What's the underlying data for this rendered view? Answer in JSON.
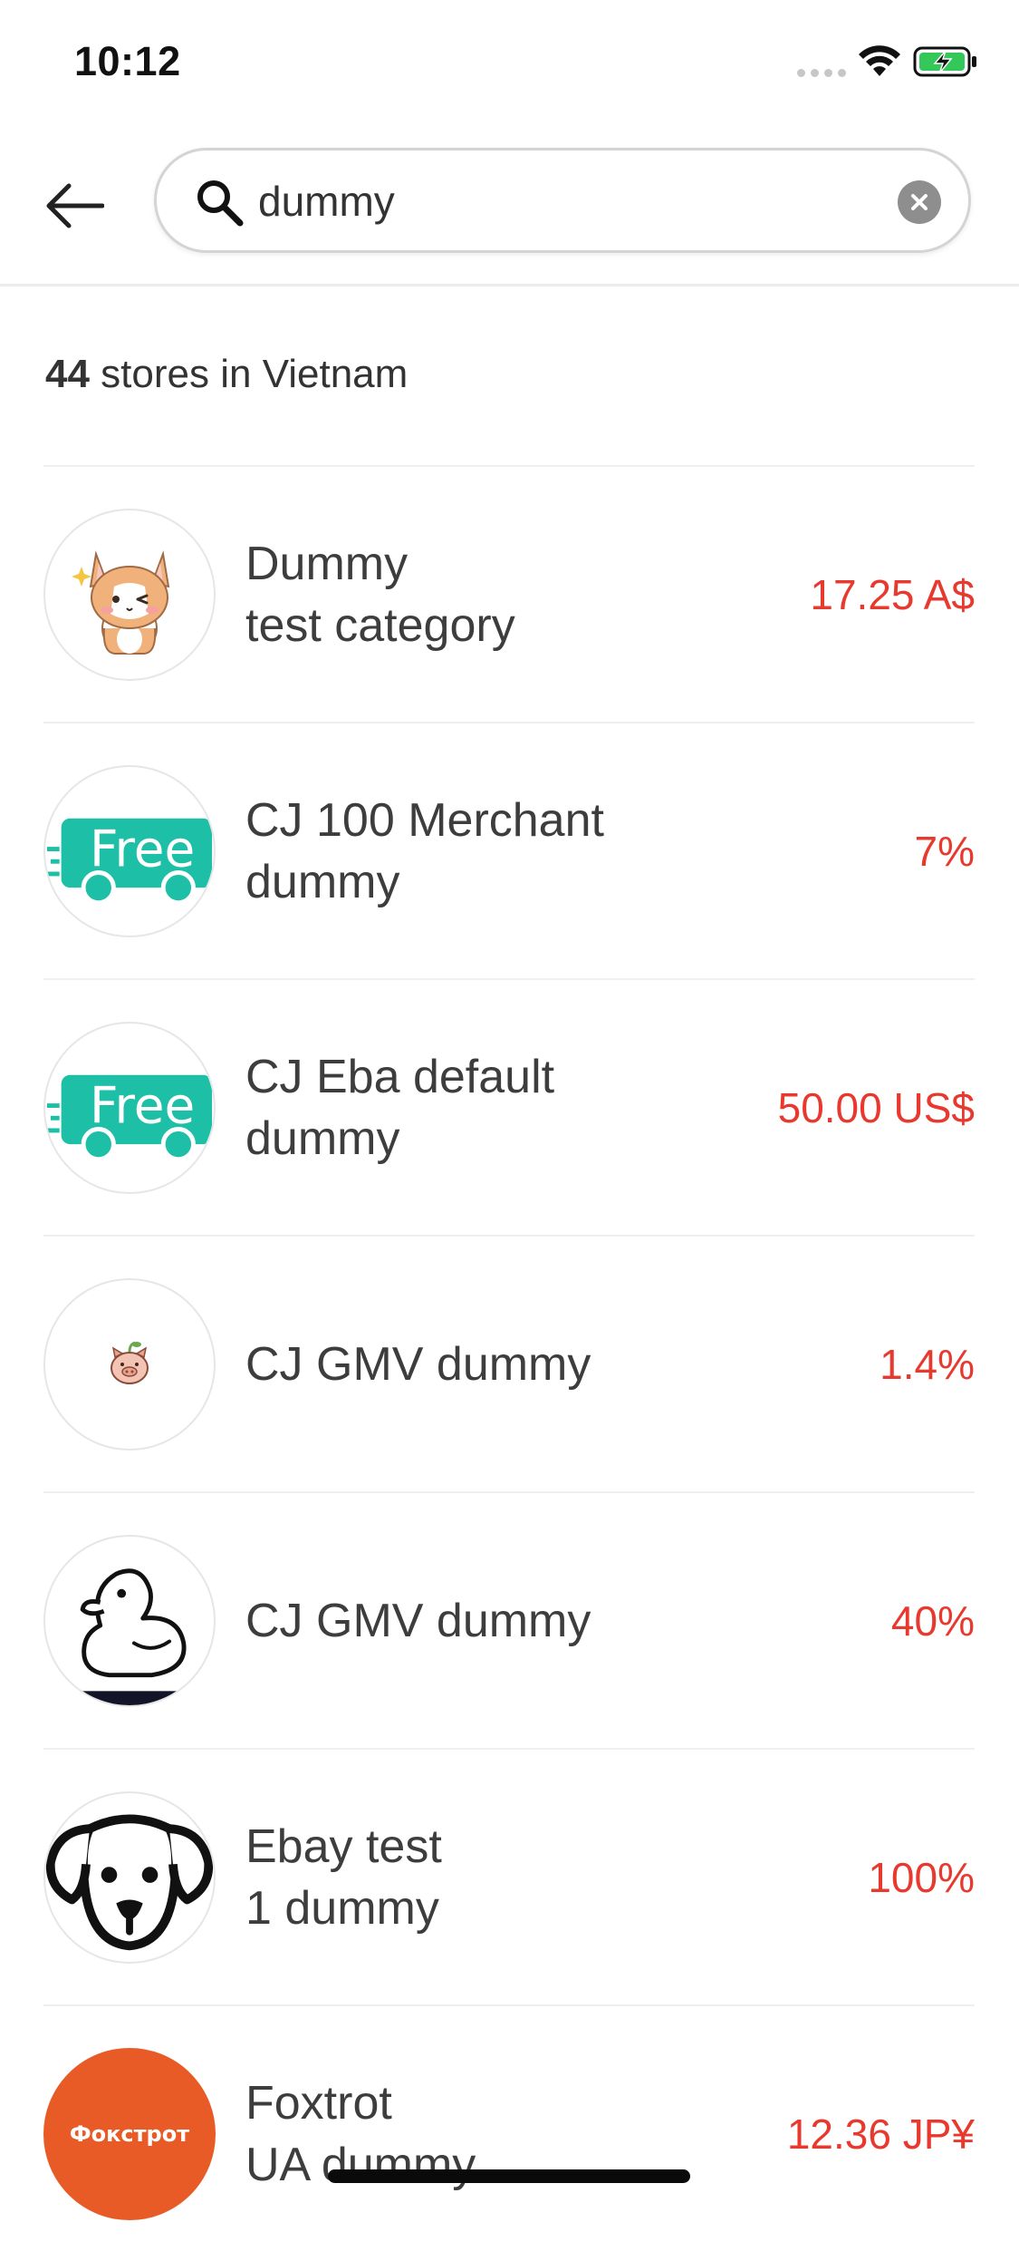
{
  "status_bar": {
    "time": "10:12"
  },
  "header": {
    "back_icon": "arrow-left-icon",
    "search": {
      "value": "dummy",
      "icon": "search-icon",
      "clear_icon": "clear-icon"
    }
  },
  "results": {
    "count": "44",
    "label": " stores in Vietnam"
  },
  "stores": [
    {
      "name_line1": "Dummy",
      "name_line2": "test category",
      "value": "17.25 A$",
      "logo": "cartoon-cat"
    },
    {
      "name_line1": "CJ 100 Merchant",
      "name_line2": "dummy",
      "value": "7%",
      "logo": "free-truck",
      "logo_text": "Free"
    },
    {
      "name_line1": "CJ Eba default",
      "name_line2": "dummy",
      "value": "50.00 US$",
      "logo": "free-truck",
      "logo_text": "Free"
    },
    {
      "name_line1": "CJ GMV dummy",
      "name_line2": "",
      "value": "1.4%",
      "logo": "small-pig"
    },
    {
      "name_line1": "CJ GMV dummy",
      "name_line2": "",
      "value": "40%",
      "logo": "duck-outline"
    },
    {
      "name_line1": "Ebay test",
      "name_line2": "1 dummy",
      "value": "100%",
      "logo": "dog-outline"
    },
    {
      "name_line1": "Foxtrot",
      "name_line2": "UA dummy",
      "value": "12.36 JP¥",
      "logo": "foxtrot-brand",
      "logo_text": "Фокстрот"
    }
  ],
  "colors": {
    "value_red": "#e8392f",
    "free_teal": "#1dbfa6",
    "foxtrot_orange": "#e85a26"
  }
}
